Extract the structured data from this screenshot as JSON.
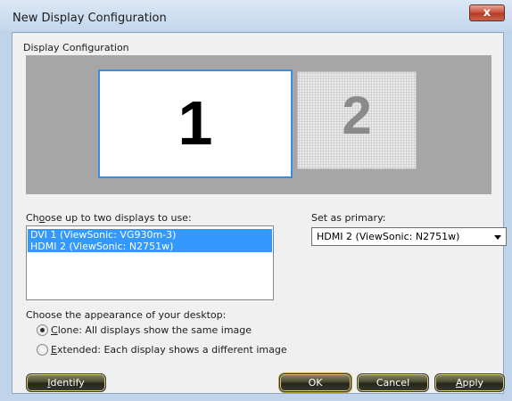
{
  "window": {
    "title": "New Display Configuration",
    "close_label": "x"
  },
  "config_group": {
    "label": "Display Configuration",
    "monitors": [
      {
        "number": "1"
      },
      {
        "number": "2"
      }
    ]
  },
  "display_list": {
    "label_prefix": "Ch",
    "label_mnemonic": "o",
    "label_suffix": "ose up to two displays to use:",
    "items": [
      "DVI 1 (ViewSonic: VG930m-3)",
      "HDMI 2 (ViewSonic: N2751w)"
    ]
  },
  "primary": {
    "label": "Set as primary:",
    "selected": "HDMI 2 (ViewSonic: N2751w)"
  },
  "appearance": {
    "label": "Choose the appearance of your desktop:",
    "clone": {
      "mnemonic": "C",
      "rest": "lone: All displays show the same image",
      "checked": true
    },
    "extended": {
      "mnemonic": "E",
      "rest": "xtended: Each display shows a different image",
      "checked": false
    }
  },
  "buttons": {
    "identify": {
      "mnemonic": "I",
      "rest": "dentify"
    },
    "ok": "OK",
    "cancel": "Cancel",
    "apply": {
      "mnemonic": "A",
      "rest": "pply"
    }
  }
}
